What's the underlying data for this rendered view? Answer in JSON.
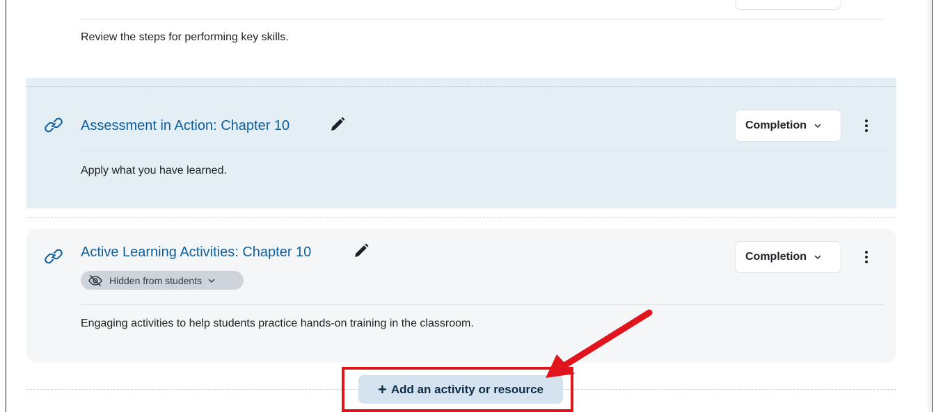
{
  "items": [
    {
      "description": "Review the steps for performing key skills."
    },
    {
      "title": "Assessment in Action: Chapter 10",
      "completion_label": "Completion",
      "description": "Apply what you have learned.",
      "icon": "link-icon"
    },
    {
      "title": "Active Learning Activities: Chapter 10",
      "completion_label": "Completion",
      "visibility_label": "Hidden from students",
      "description": "Engaging activities to help students practice hands-on training in the classroom.",
      "icon": "link-icon"
    }
  ],
  "add_button": {
    "plus": "+",
    "label": "Add an activity or resource"
  },
  "colors": {
    "link": "#0f5e9c",
    "highlight": "#e3eef5",
    "card": "#f5f6f8",
    "annotation_red": "#e0141d",
    "add_button_bg": "#d4e3ef"
  }
}
